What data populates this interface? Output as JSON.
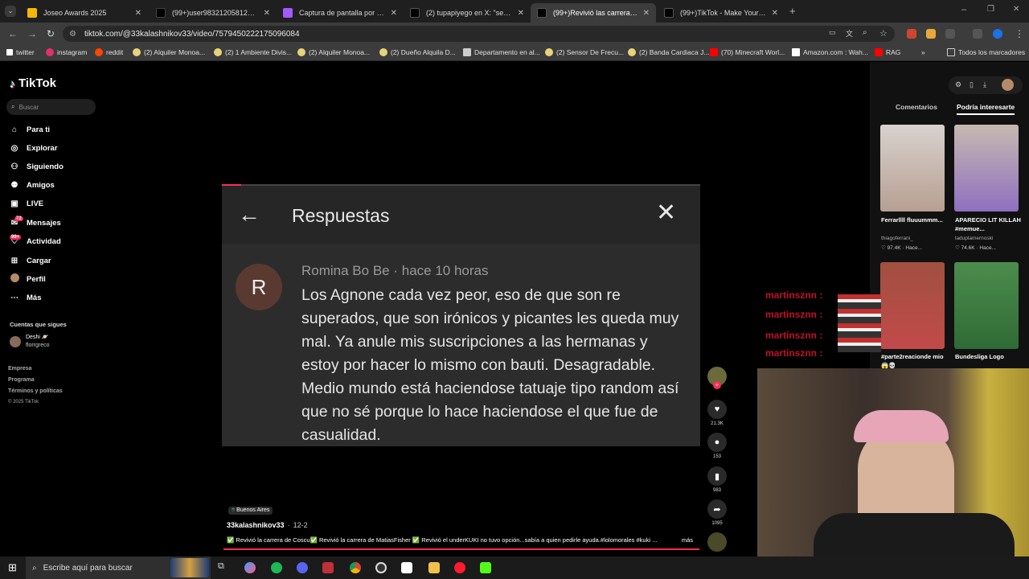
{
  "tabs": [
    {
      "title": "Joseo Awards 2025",
      "color": "#f5b800"
    },
    {
      "title": "(99+)user983212058129 (@use",
      "color": "#ffffff"
    },
    {
      "title": "Captura de pantalla por Lightsh",
      "color": "#a259ff"
    },
    {
      "title": "(2) tupapiyego en X: \"se le rien",
      "color": "#ffffff"
    },
    {
      "title": "(99+)Revivió las carreras de Co",
      "color": "#ffffff"
    },
    {
      "title": "(99+)TikTok - Make Your Day",
      "color": "#ffffff"
    }
  ],
  "url": "tiktok.com/@33kalashnikov33/video/7579450222175096084",
  "bookmarks": [
    {
      "label": "twitter",
      "color": "#ffffff"
    },
    {
      "label": "instagram",
      "color": "#e1306c"
    },
    {
      "label": "reddit",
      "color": "#ff4500"
    },
    {
      "label": "(2) Alquiler Monoa...",
      "color": "#e6d37a"
    },
    {
      "label": "(2) 1 Ambiente Divis...",
      "color": "#e6d37a"
    },
    {
      "label": "(2) Alquiler Monoa...",
      "color": "#e6d37a"
    },
    {
      "label": "(2) Dueño Alquila D...",
      "color": "#e6d37a"
    },
    {
      "label": "Departamento en al...",
      "color": "#cccccc"
    },
    {
      "label": "(2) Sensor De Frecu...",
      "color": "#e6d37a"
    },
    {
      "label": "(2) Banda Cardiaca J...",
      "color": "#e6d37a"
    },
    {
      "label": "(70) Minecraft Worl...",
      "color": "#ff0000"
    },
    {
      "label": "Amazon.com : Wah...",
      "color": "#ffffff"
    },
    {
      "label": "RAG",
      "color": "#ff0000"
    }
  ],
  "bookmarks_other": "Todos los marcadores",
  "sidebar": {
    "logo": "TikTok",
    "search_placeholder": "Buscar",
    "items": [
      {
        "label": "Para ti",
        "icon": "home-icon"
      },
      {
        "label": "Explorar",
        "icon": "compass-icon"
      },
      {
        "label": "Siguiendo",
        "icon": "following-icon"
      },
      {
        "label": "Amigos",
        "icon": "friends-icon"
      },
      {
        "label": "LIVE",
        "icon": "live-icon"
      },
      {
        "label": "Mensajes",
        "icon": "messages-icon",
        "badge": "72"
      },
      {
        "label": "Actividad",
        "icon": "activity-icon",
        "badge": "99+"
      },
      {
        "label": "Cargar",
        "icon": "upload-icon"
      },
      {
        "label": "Perfil",
        "icon": "profile-icon"
      },
      {
        "label": "Más",
        "icon": "more-icon"
      }
    ],
    "following_title": "Cuentas que sigues",
    "following_user_name": "Deshi 🪐",
    "following_user_handle": "florrgreco",
    "footer": [
      "Empresa",
      "Programa",
      "Términos y políticas",
      "© 2025 TikTok"
    ]
  },
  "comment_card": {
    "title": "Respuestas",
    "avatar_letter": "R",
    "author": "Romina Bo Be",
    "time": "hace 10 horas",
    "text": "Los Agnone cada vez peor, eso de que son re superados, que son irónicos y picantes les queda muy mal. Ya anule mis suscripciones a las hermanas y estoy por hacer lo mismo con bauti. Desagradable. Medio mundo está haciendose tatuaje tipo random así que no sé porque lo hace haciendose el que fue de casualidad."
  },
  "actions": {
    "likes": "21.3K",
    "comments": "153",
    "saves": "983",
    "shares": "1095"
  },
  "video_info": {
    "location": "Buenos Aires",
    "author": "33kalashnikov33",
    "date": "12-2",
    "caption": "✅ Revivió la carrera de Coscu✅ Revivió la carrera de MatiasFisher ✅ Revivió el underKUKI no tuvo opción...sabía a quien pedirle ayuda.#lolomorales #kuki ...",
    "more": "más"
  },
  "right_panel": {
    "tab_comments": "Comentarios",
    "tab_interest": "Podría interesarte",
    "videos": [
      {
        "caption": "Ferrarllll fluuummm...",
        "user": "thiagoferrani_",
        "stats": "♡ 97.4K · Hace..."
      },
      {
        "caption": "APARECIO LIT KILLAH #memue...",
        "user": "laduplamernoski",
        "stats": "♡ 74.6K · Hace..."
      },
      {
        "caption": "#parte2reacionde mio😱💀",
        "user": "",
        "stats": ""
      },
      {
        "caption": "Bundesliga Logo",
        "user": "",
        "stats": ""
      }
    ]
  },
  "chat_overlay": [
    "martinsznn :",
    "martinsznn :",
    "martinsznn :",
    "martinsznn :"
  ],
  "taskbar": {
    "search_placeholder": "Escribe aquí para buscar"
  },
  "progress_fraction": 0.04
}
